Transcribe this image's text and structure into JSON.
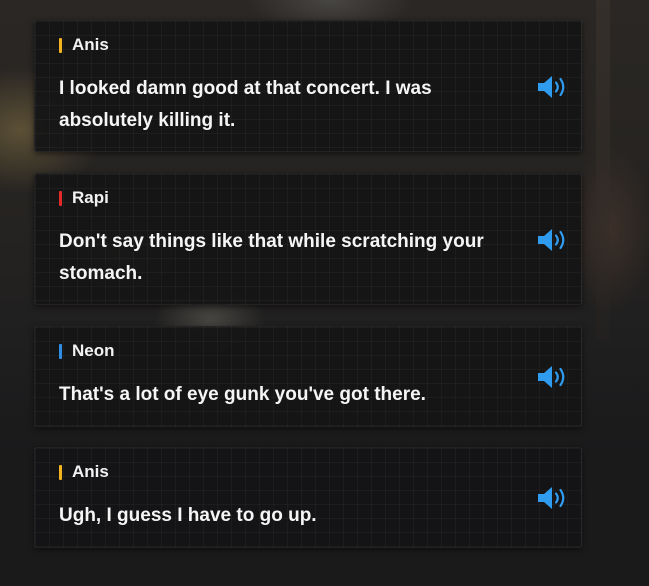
{
  "colors": {
    "anis": "#f4b41f",
    "rapi": "#e52a2a",
    "neon": "#2f8fe6",
    "voice_icon": "#2f9cf0"
  },
  "entries": [
    {
      "speaker": "Anis",
      "color_key": "anis",
      "text": "I looked damn good at that concert. I was absolutely killing it.",
      "icon": "speaker-icon"
    },
    {
      "speaker": "Rapi",
      "color_key": "rapi",
      "text": "Don't say things like that while scratching your stomach.",
      "icon": "speaker-icon"
    },
    {
      "speaker": "Neon",
      "color_key": "neon",
      "text": "That's a lot of eye gunk you've got there.",
      "icon": "speaker-icon"
    },
    {
      "speaker": "Anis",
      "color_key": "anis",
      "text": "Ugh, I guess I have to go up.",
      "icon": "speaker-icon"
    }
  ]
}
